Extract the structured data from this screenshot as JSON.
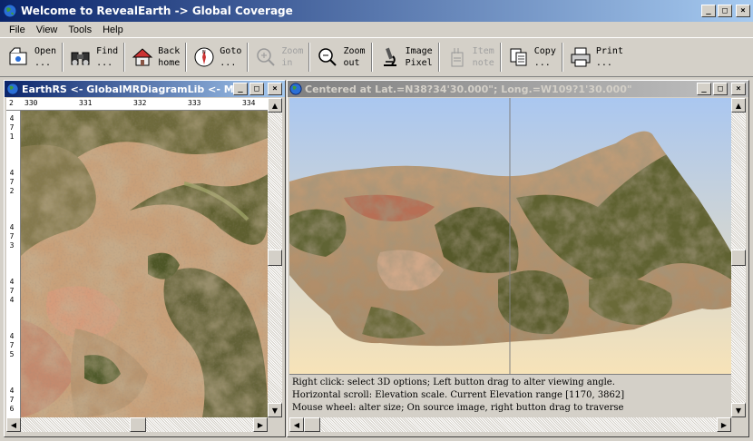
{
  "app": {
    "title": "Welcome to RevealEarth -> Global Coverage"
  },
  "menu": [
    "File",
    "View",
    "Tools",
    "Help"
  ],
  "toolbar": [
    {
      "label": "Open\n...",
      "icon": "open-icon",
      "enabled": true
    },
    {
      "label": "Find\n...",
      "icon": "binoculars-icon",
      "enabled": true
    },
    {
      "label": "Back\nhome",
      "icon": "home-icon",
      "enabled": true
    },
    {
      "label": "Goto\n...",
      "icon": "compass-icon",
      "enabled": true
    },
    {
      "label": "Zoom\nin",
      "icon": "zoom-in-icon",
      "enabled": false
    },
    {
      "label": "Zoom\nout",
      "icon": "zoom-out-icon",
      "enabled": true
    },
    {
      "label": "Image\nPixel",
      "icon": "microscope-icon",
      "enabled": true
    },
    {
      "label": "Item\nnote",
      "icon": "note-icon",
      "enabled": false
    },
    {
      "label": "Copy\n...",
      "icon": "copy-icon",
      "enabled": true
    },
    {
      "label": "Print\n...",
      "icon": "printer-icon",
      "enabled": true
    }
  ],
  "left_window": {
    "title": "EarthRS <- GlobalMRDiagramLib <- Mi...",
    "ruler_corner": "2",
    "ruler_x": [
      "330",
      "331",
      "332",
      "333",
      "334"
    ],
    "ruler_y": [
      "471",
      "472",
      "473",
      "474",
      "475",
      "476"
    ]
  },
  "right_window": {
    "title": "Centered at Lat.=N38?34'30.000\"; Long.=W109?1'30.000\"",
    "info_lines": [
      "Right click: select 3D options; Left button drag to alter viewing angle.",
      "Horizontal scroll: Elevation scale. Current Elevation range [1170, 3862]",
      "Mouse wheel: alter size; On source image, right button drag to traverse"
    ]
  },
  "colors": {
    "title_active": "#0a246a",
    "title_gradient_end": "#a6caf0",
    "title_inactive": "#808080",
    "chrome": "#d4d0c8",
    "sky_top": "#aac7f0",
    "sky_bottom": "#f7e3b8"
  }
}
